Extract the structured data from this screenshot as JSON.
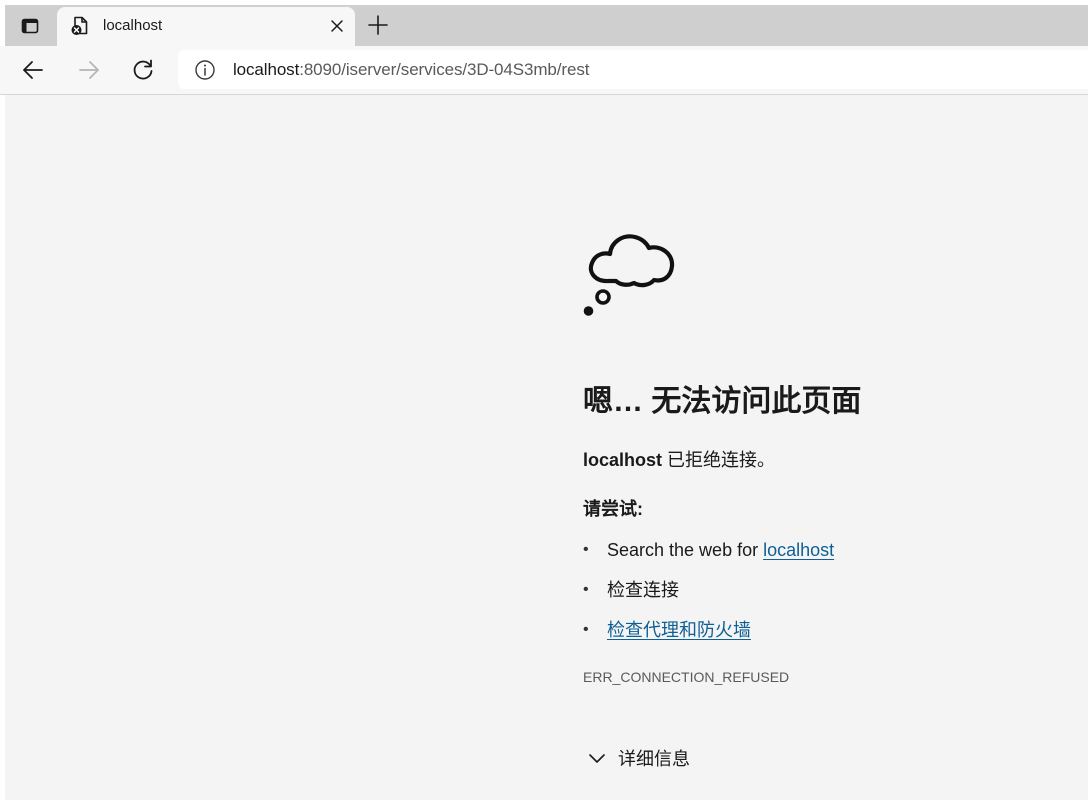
{
  "browser": {
    "tab": {
      "title": "localhost",
      "favicon": "error-page-icon"
    },
    "toolbar": {
      "back_icon": "back-arrow-icon",
      "forward_icon": "forward-arrow-icon",
      "refresh_icon": "refresh-icon",
      "info_icon": "info-icon",
      "url_host": "localhost",
      "url_rest": ":8090/iserver/services/3D-04S3mb/rest"
    }
  },
  "error_page": {
    "illustration": "thought-cloud-icon",
    "title": "嗯… 无法访问此页面",
    "host": "localhost",
    "message": " 已拒绝连接。",
    "try_label": "请尝试:",
    "suggestions": [
      {
        "prefix": "Search the web for ",
        "link": "localhost"
      },
      {
        "text": "检查连接"
      },
      {
        "link": "检查代理和防火墙"
      }
    ],
    "error_code": "ERR_CONNECTION_REFUSED",
    "details_label": "详细信息"
  },
  "colors": {
    "link": "#0f5f95",
    "content_bg": "#f4f4f4",
    "tabstrip_bg": "#cfcfcf"
  }
}
